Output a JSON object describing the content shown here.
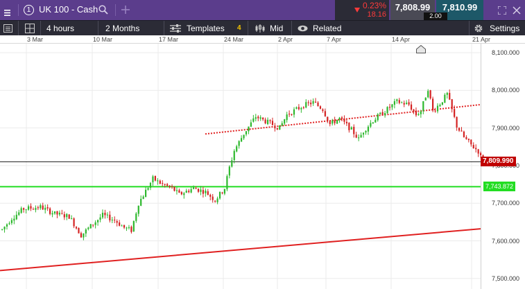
{
  "topbar": {
    "menu_icon": "hamburger-menu-icon",
    "instrument_number": "1",
    "instrument_name": "UK 100 - Cash",
    "search_icon": "search-icon",
    "add_icon": "plus-icon",
    "change_percent": "0.23%",
    "change_points": "18.16",
    "sell_price": "7,808.99",
    "buy_price": "7,810.99",
    "spread": "2.00",
    "expand_icon": "expand-arrows-icon",
    "close_icon": "close-icon"
  },
  "toolbar": {
    "settings_panel_icon": "panel-icon",
    "layout_icon": "grid-layout-icon",
    "interval": "4 hours",
    "range": "2 Months",
    "templates_label": "Templates",
    "templates_count": "4",
    "price_type": "Mid",
    "related_label": "Related",
    "settings_label": "Settings"
  },
  "colors": {
    "topbar_bg": "#5b3d8c",
    "toolbar_bg": "#2b2b36",
    "up_candle": "#2db82d",
    "down_candle": "#d42222",
    "support_line": "#22dd22",
    "trend_line": "#e02020",
    "price_tag": "#c00000"
  },
  "chart_data": {
    "type": "candlestick",
    "x_tick_labels": [
      "3 Mar",
      "10 Mar",
      "17 Mar",
      "24 Mar",
      "2 Apr",
      "7 Apr",
      "14 Apr",
      "21 Apr"
    ],
    "y_tick_labels": [
      "8,100.000",
      "8,000.000",
      "7,900.000",
      "7,800.000",
      "7,700.000",
      "7,600.000",
      "7,500.000"
    ],
    "y_ticks": [
      8100,
      8000,
      7900,
      7800,
      7700,
      7600,
      7500
    ],
    "ylim": [
      7472,
      8124
    ],
    "grid": true,
    "current_price": 7809.99,
    "current_price_label": "7,809.990",
    "horizontal_level": 7743.872,
    "horizontal_level_label": "7,743.872",
    "rising_support_trendline": {
      "style": "solid",
      "start": 7521,
      "end": 7632
    },
    "dotted_trendline": {
      "style": "dotted",
      "start": 7884,
      "end": 7962
    },
    "series_path": [
      [
        0,
        7630
      ],
      [
        4,
        7660
      ],
      [
        9,
        7685
      ],
      [
        16,
        7690
      ],
      [
        22,
        7672
      ],
      [
        28,
        7665
      ],
      [
        33,
        7615
      ],
      [
        38,
        7645
      ],
      [
        42,
        7668
      ],
      [
        47,
        7655
      ],
      [
        51,
        7635
      ],
      [
        54,
        7628
      ],
      [
        57,
        7700
      ],
      [
        63,
        7765
      ],
      [
        67,
        7750
      ],
      [
        71,
        7740
      ],
      [
        74,
        7723
      ],
      [
        80,
        7740
      ],
      [
        85,
        7730
      ],
      [
        89,
        7708
      ],
      [
        93,
        7740
      ],
      [
        95,
        7795
      ],
      [
        97,
        7840
      ],
      [
        101,
        7885
      ],
      [
        106,
        7930
      ],
      [
        111,
        7915
      ],
      [
        116,
        7900
      ],
      [
        119,
        7935
      ],
      [
        126,
        7960
      ],
      [
        130,
        7968
      ],
      [
        134,
        7950
      ],
      [
        137,
        7910
      ],
      [
        141,
        7925
      ],
      [
        146,
        7895
      ],
      [
        149,
        7870
      ],
      [
        151,
        7892
      ],
      [
        155,
        7920
      ],
      [
        160,
        7945
      ],
      [
        165,
        7970
      ],
      [
        170,
        7962
      ],
      [
        173,
        7935
      ],
      [
        175,
        7945
      ],
      [
        178,
        8005
      ],
      [
        180,
        7945
      ],
      [
        183,
        7965
      ],
      [
        186,
        7990
      ],
      [
        190,
        7905
      ],
      [
        193,
        7875
      ],
      [
        196,
        7855
      ],
      [
        199,
        7838
      ],
      [
        201,
        7808
      ],
      [
        203,
        7815
      ]
    ]
  }
}
